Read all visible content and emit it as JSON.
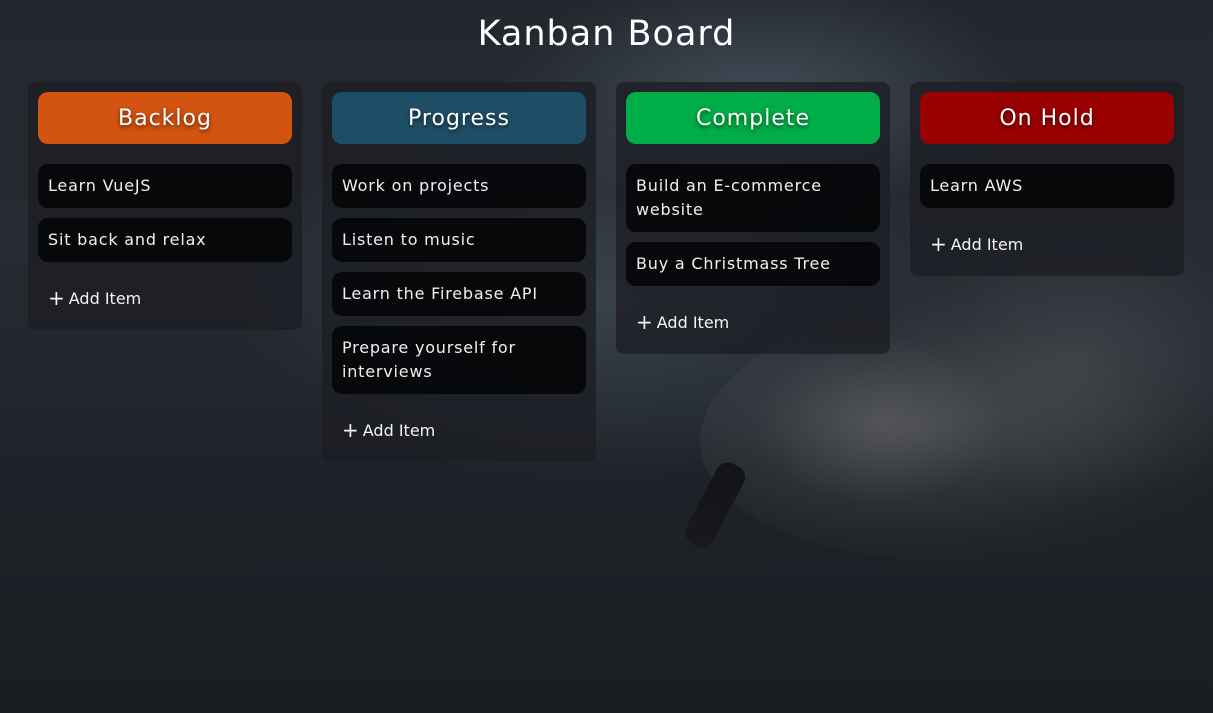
{
  "title": "Kanban Board",
  "add_label": "Add Item",
  "columns": [
    {
      "name": "Backlog",
      "color": "#d35410",
      "items": [
        "Learn VueJS",
        "Sit back and relax"
      ]
    },
    {
      "name": "Progress",
      "color": "#1e4e66",
      "items": [
        "Work on projects",
        "Listen to music",
        "Learn the Firebase API",
        "Prepare yourself for interviews"
      ]
    },
    {
      "name": "Complete",
      "color": "#00ad46",
      "items": [
        "Build an E-commerce website",
        "Buy a Christmass Tree"
      ]
    },
    {
      "name": "On Hold",
      "color": "#990000",
      "items": [
        "Learn AWS"
      ]
    }
  ]
}
